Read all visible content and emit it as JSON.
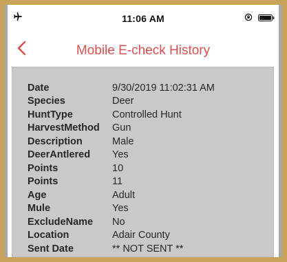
{
  "status_bar": {
    "time": "11:06 AM",
    "left_icon": "airplane-icon",
    "right_icons": [
      "lock-rotation-icon",
      "battery-icon"
    ]
  },
  "nav": {
    "back_icon": "chevron-left-icon",
    "title": "Mobile E-check History"
  },
  "colors": {
    "accent": "#e04e4e",
    "frame_border": "#c9a35a",
    "panel_background": "#c9c9c9",
    "text": "#262626"
  },
  "details": [
    {
      "label": "Date",
      "value": "9/30/2019 11:02:31 AM"
    },
    {
      "label": "Species",
      "value": "Deer"
    },
    {
      "label": "HuntType",
      "value": "Controlled Hunt"
    },
    {
      "label": "HarvestMethod",
      "value": "Gun"
    },
    {
      "label": "Description",
      "value": "Male"
    },
    {
      "label": "DeerAntlered",
      "value": "Yes"
    },
    {
      "label": "Points",
      "value": "10"
    },
    {
      "label": "Points",
      "value": "11"
    },
    {
      "label": "Age",
      "value": "Adult"
    },
    {
      "label": "Mule",
      "value": "Yes"
    },
    {
      "label": "ExcludeName",
      "value": "No"
    },
    {
      "label": "Location",
      "value": "Adair County"
    },
    {
      "label": "Sent Date",
      "value": "** NOT SENT **"
    }
  ]
}
